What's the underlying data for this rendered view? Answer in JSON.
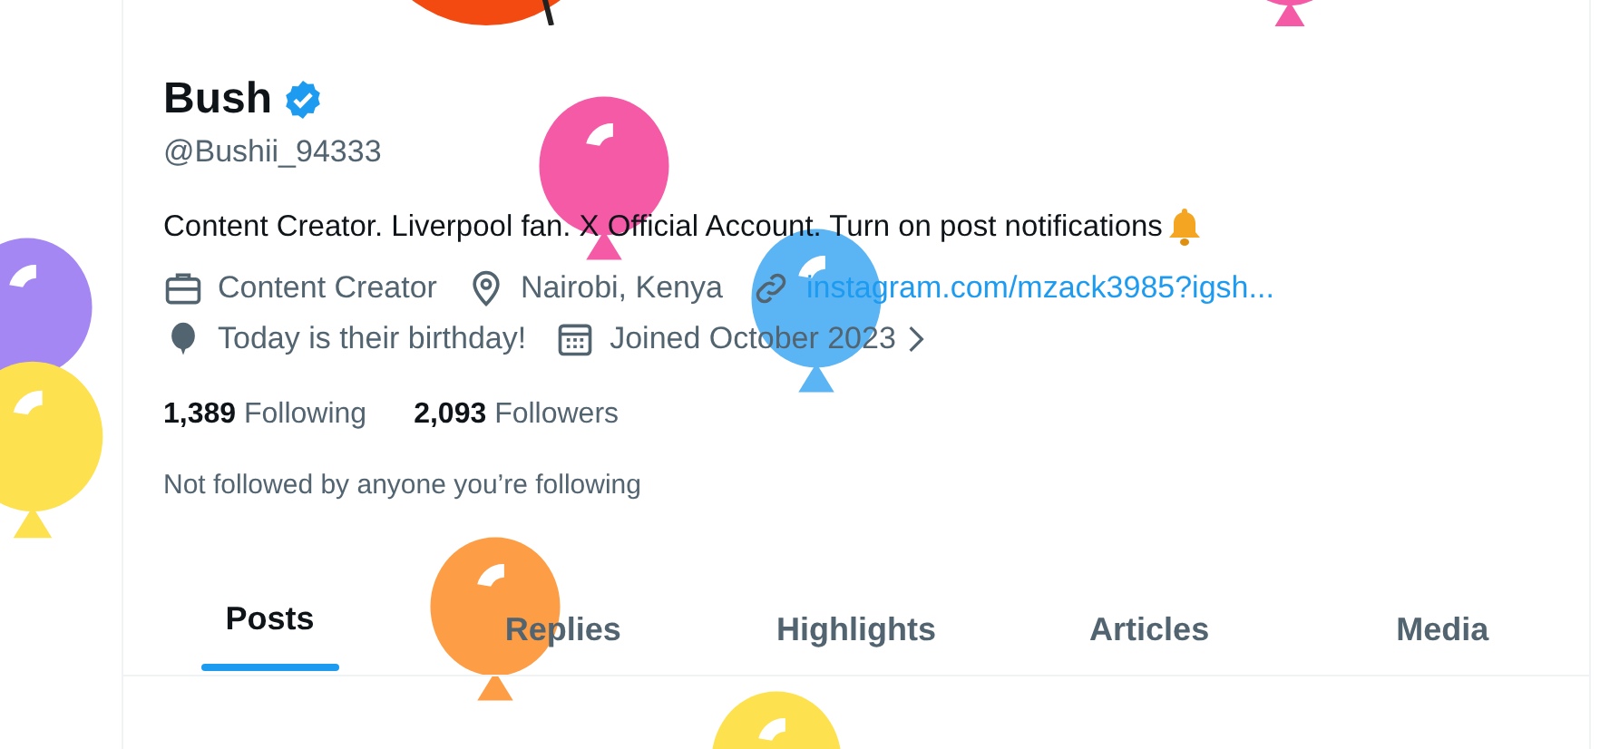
{
  "profile": {
    "name": "Bush",
    "verified": true,
    "handle": "@Bushii_94333",
    "bio": "Content Creator. Liverpool fan. X Official Account. Turn on post notifications",
    "meta": [
      {
        "kind": "job",
        "text": "Content Creator"
      },
      {
        "kind": "location",
        "text": "Nairobi, Kenya"
      },
      {
        "kind": "link",
        "text": "instagram.com/mzack3985?igsh..."
      },
      {
        "kind": "birthday",
        "text": "Today is their birthday!"
      },
      {
        "kind": "joined",
        "text": "Joined October 2023"
      }
    ],
    "stats": [
      {
        "count": "1,389",
        "label": "Following"
      },
      {
        "count": "2,093",
        "label": "Followers"
      }
    ],
    "followed_by": "Not followed by anyone you’re following"
  },
  "tabs": [
    {
      "label": "Posts",
      "selected": true
    },
    {
      "label": "Replies",
      "selected": false
    },
    {
      "label": "Highlights",
      "selected": false
    },
    {
      "label": "Articles",
      "selected": false
    },
    {
      "label": "Media",
      "selected": false
    }
  ]
}
